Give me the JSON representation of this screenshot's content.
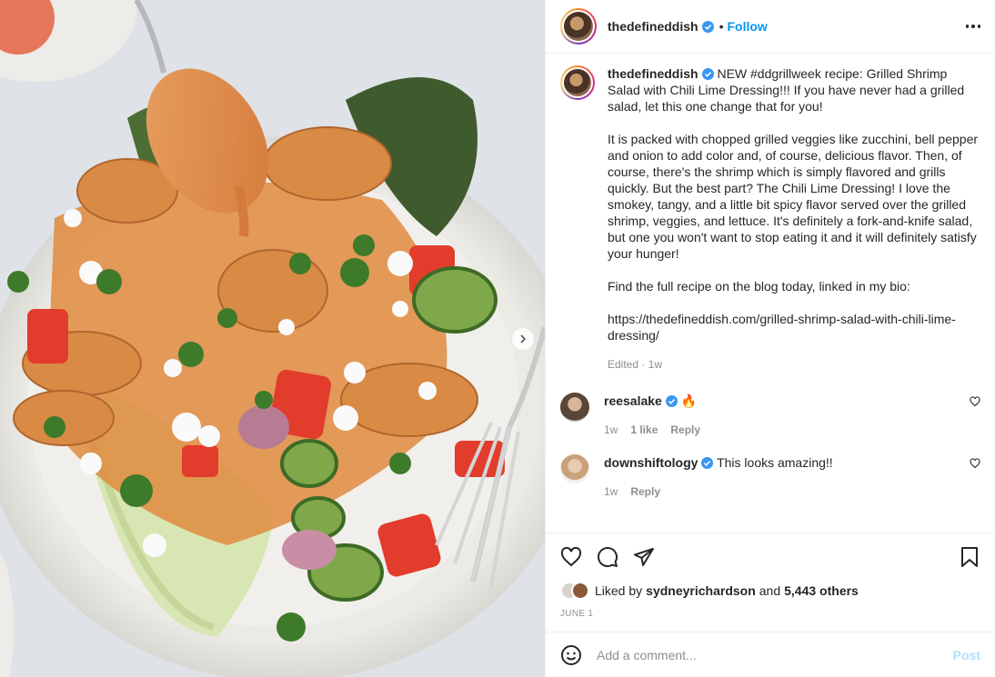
{
  "post": {
    "username": "thedefineddish",
    "follow_label": "Follow",
    "separator": "•"
  },
  "caption": {
    "username": "thedefineddish",
    "intro": "NEW #ddgrillweek recipe: Grilled Shrimp Salad with Chili Lime Dressing!!! If you have never had a grilled salad, let this one change that for you!",
    "para1": "It is packed with chopped grilled veggies like zucchini, bell pepper and onion to add color and, of course, delicious flavor. Then, of course, there's the shrimp which is simply flavored and grills quickly. But the best part? The Chili Lime Dressing! I love the smokey, tangy, and a little bit spicy flavor served over the grilled shrimp, veggies, and lettuce. It's definitely a fork-and-knife salad, but one you won't want to stop eating it and it will definitely satisfy your hunger!",
    "para2": "Find the full recipe on the blog today, linked in my bio:",
    "link": "https://thedefineddish.com/grilled-shrimp-salad-with-chili-lime-dressing/",
    "edited": "Edited · 1w"
  },
  "comments": [
    {
      "username": "reesalake",
      "text": "🔥",
      "time": "1w",
      "likes": "1 like",
      "reply": "Reply"
    },
    {
      "username": "downshiftology",
      "text": "This looks amazing!!",
      "time": "1w",
      "reply": "Reply"
    }
  ],
  "likes": {
    "prefix": "Liked by",
    "user": "sydneyrichardson",
    "and": "and",
    "others": "5,443 others"
  },
  "date": "June 1",
  "add_comment": {
    "placeholder": "Add a comment...",
    "post_label": "Post"
  },
  "colors": {
    "accent": "#0095f6",
    "verified": "#3897f0",
    "post_disabled": "#b2dffc",
    "muted": "#8e8e8e"
  },
  "icons": [
    "next-arrow-icon",
    "more-icon",
    "verified-icon",
    "heart-icon",
    "comment-icon",
    "share-icon",
    "bookmark-icon",
    "emoji-icon"
  ]
}
